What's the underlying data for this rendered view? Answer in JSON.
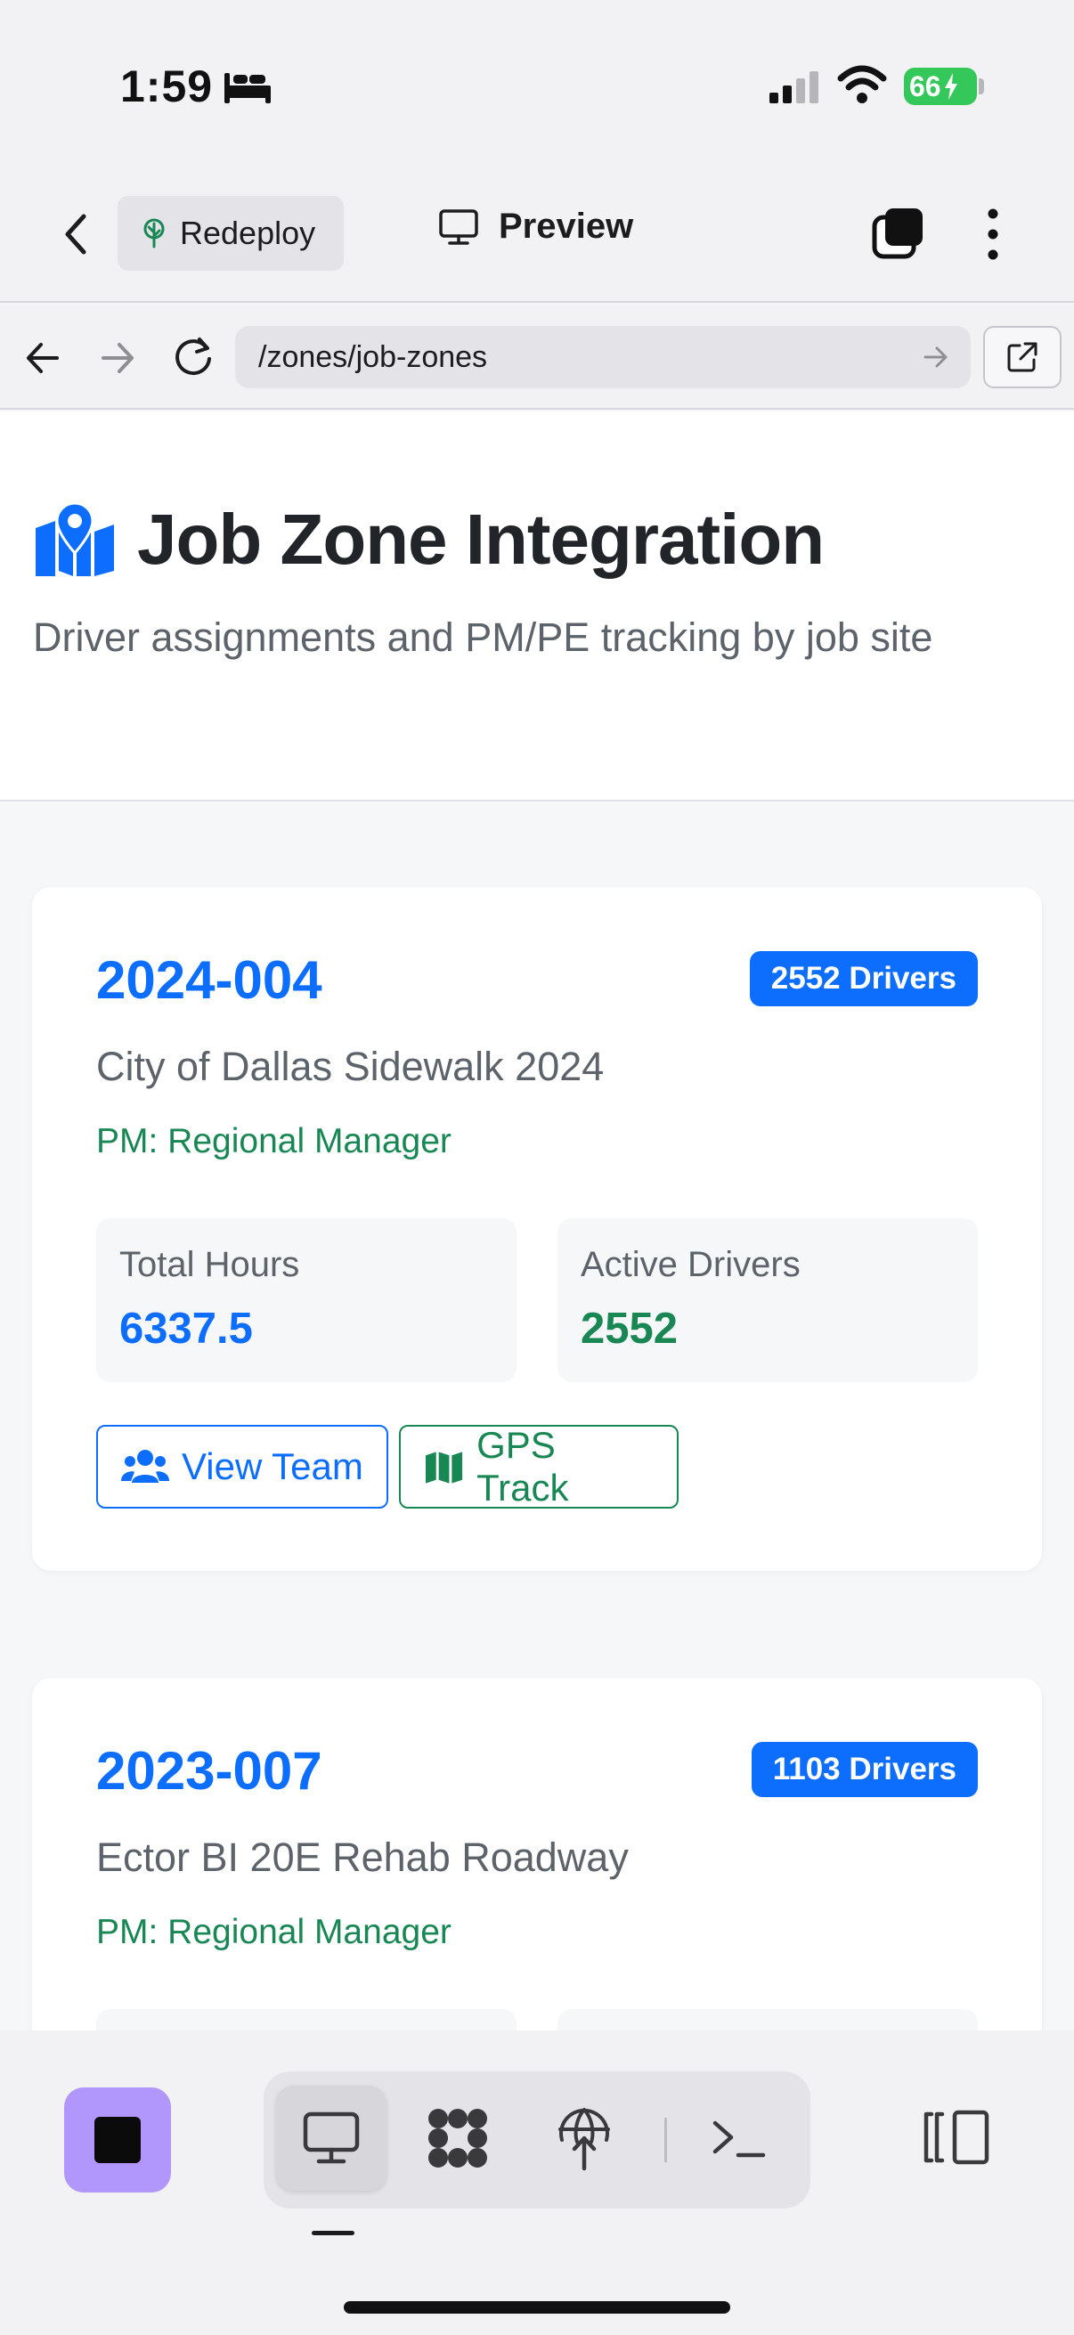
{
  "status_bar": {
    "time": "1:59",
    "battery": "66",
    "icons": [
      "bed-icon",
      "signal-icon",
      "wifi-icon",
      "battery-icon"
    ]
  },
  "app_header": {
    "back_icon": "chevron-left-icon",
    "redeploy_label": "Redeploy",
    "redeploy_icon": "tree-icon",
    "preview_label": "Preview",
    "preview_icon": "monitor-icon",
    "tabs_icon": "tabs-icon",
    "menu_icon": "more-vertical-icon"
  },
  "url_bar": {
    "url": "/zones/job-zones",
    "icons": [
      "arrow-left-icon",
      "arrow-right-icon",
      "reload-icon",
      "go-arrow-icon",
      "external-link-icon"
    ]
  },
  "page": {
    "title": "Job Zone Integration",
    "title_icon": "map-marker-icon",
    "subtitle": "Driver assignments and PM/PE tracking by job site"
  },
  "jobs": [
    {
      "id": "2024-004",
      "badge": "2552 Drivers",
      "name": "City of Dallas Sidewalk 2024",
      "pm": "PM: Regional Manager",
      "total_hours_label": "Total Hours",
      "total_hours": "6337.5",
      "active_drivers_label": "Active Drivers",
      "active_drivers": "2552",
      "view_team_label": "View Team",
      "gps_track_label": "GPS Track"
    },
    {
      "id": "2023-007",
      "badge": "1103 Drivers",
      "name": "Ector BI 20E Rehab Roadway",
      "pm": "PM: Regional Manager"
    }
  ],
  "bottom_toolbar": {
    "stop_icon": "stop-icon",
    "tools": [
      "monitor-icon",
      "apps-icon",
      "globe-upload-icon",
      "terminal-icon"
    ],
    "active_tool": "monitor-icon",
    "panel_icon": "panel-toggle-icon"
  },
  "colors": {
    "primary": "#0d6efd",
    "success": "#198754",
    "muted": "#5c636a",
    "stop_button": "#b197fc",
    "battery": "#34c759"
  }
}
